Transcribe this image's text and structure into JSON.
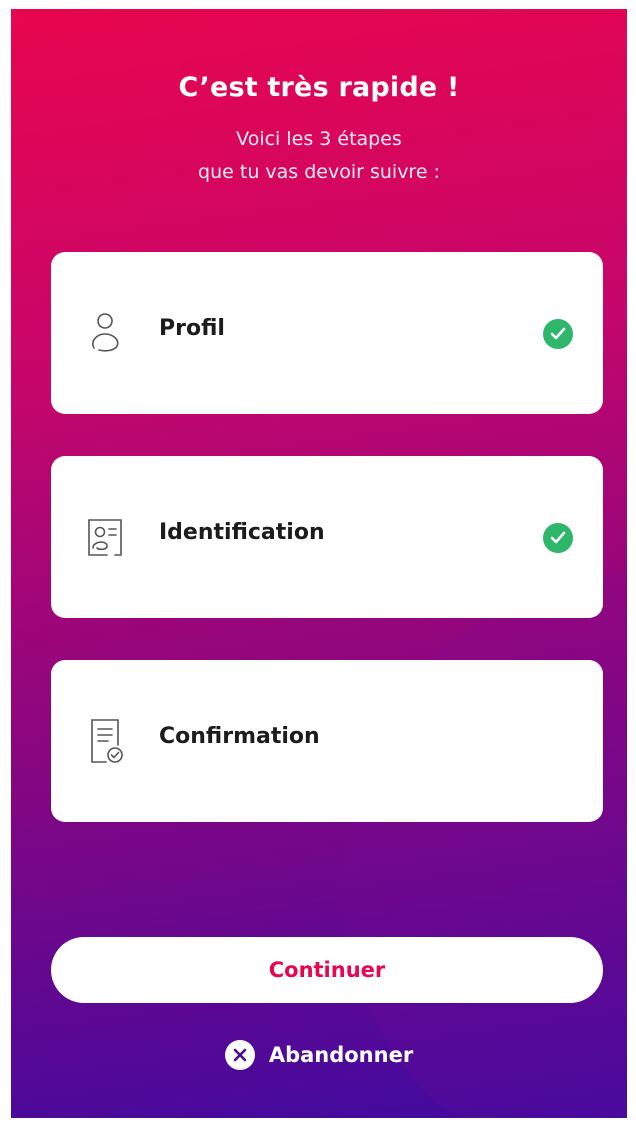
{
  "header": {
    "title": "C’est très rapide !",
    "subtitle_line1": "Voici les 3 étapes",
    "subtitle_line2": "que tu vas devoir suivre :"
  },
  "steps": [
    {
      "label": "Profil",
      "icon": "profile-icon",
      "completed": true
    },
    {
      "label": "Identification",
      "icon": "id-card-icon",
      "completed": true
    },
    {
      "label": "Confirmation",
      "icon": "document-check-icon",
      "completed": false
    }
  ],
  "actions": {
    "continue_label": "Continuer",
    "abandon_label": "Abandonner",
    "abandon_icon": "close-circle-icon"
  },
  "colors": {
    "gradient_top": "#e8064e",
    "gradient_bottom": "#3e0aa0",
    "accent": "#e5074f",
    "success": "#2eb66b"
  }
}
